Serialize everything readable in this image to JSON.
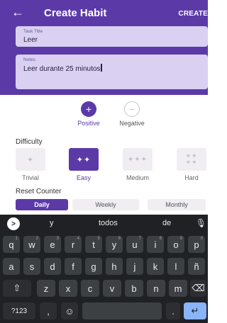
{
  "header": {
    "back_icon": "arrow-left-icon",
    "title": "Create Habit",
    "create_label": "CREATE"
  },
  "form": {
    "task_title_label": "Task Title",
    "task_title_value": "Leer",
    "notes_label": "Notes",
    "notes_value": "Leer durante 25 minutos"
  },
  "type": {
    "positive_label": "Positive",
    "negative_label": "Negative"
  },
  "difficulty": {
    "label": "Difficulty",
    "options": [
      "Trivial",
      "Easy",
      "Medium",
      "Hard"
    ],
    "selected": "Easy"
  },
  "reset_counter": {
    "label": "Reset Counter",
    "options": [
      "Daily",
      "Weekly",
      "Monthly"
    ],
    "selected": "Daily"
  },
  "keyboard": {
    "suggestions": [
      "y",
      "todos",
      "de"
    ],
    "row1": [
      "q",
      "w",
      "e",
      "r",
      "t",
      "y",
      "u",
      "i",
      "o",
      "p"
    ],
    "row1_hints": [
      "1",
      "2",
      "3",
      "4",
      "5",
      "6",
      "7",
      "8",
      "9",
      "0"
    ],
    "row2": [
      "a",
      "s",
      "d",
      "f",
      "g",
      "h",
      "j",
      "k",
      "l",
      "ñ"
    ],
    "row3": [
      "z",
      "x",
      "c",
      "v",
      "b",
      "n",
      "m"
    ],
    "symbols_key": "?123",
    "comma_key": ",",
    "period_key": ".",
    "shift_icon": "shift-icon",
    "backspace_icon": "backspace-icon",
    "emoji_icon": "emoji-icon",
    "enter_icon": "enter-icon",
    "mic_icon": "mic-icon"
  },
  "colors": {
    "primary": "#5b3aa8",
    "field_bg": "#d9d0f2",
    "keyboard_bg": "#202124",
    "key_bg": "#3c4043",
    "enter_key": "#8ab4f8"
  }
}
